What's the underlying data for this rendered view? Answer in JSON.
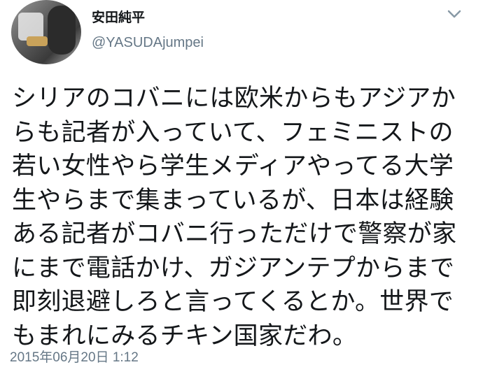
{
  "author": {
    "display_name": "安田純平",
    "handle": "@YASUDAjumpei",
    "avatar_icon": "user-avatar-photo"
  },
  "menu_icon": "chevron-down-icon",
  "tweet": {
    "lines": [
      "シリアのコバニには欧米からもアジアか",
      "らも記者が入っていて、フェミニストの",
      "若い女性やら学生メディアやってる大学",
      "生やらまで集まっているが、日本は経験",
      "ある記者がコバニ行っただけで警察が家",
      "にまで電話かけ、ガジアンテプからまで",
      "即刻退避しろと言ってくるとか。世界で",
      "もまれにみるチキン国家だわ。"
    ],
    "timestamp": "2015年06月20日 1:12"
  },
  "colors": {
    "text": "#14171a",
    "secondary_text": "#657786",
    "background": "#ffffff"
  }
}
